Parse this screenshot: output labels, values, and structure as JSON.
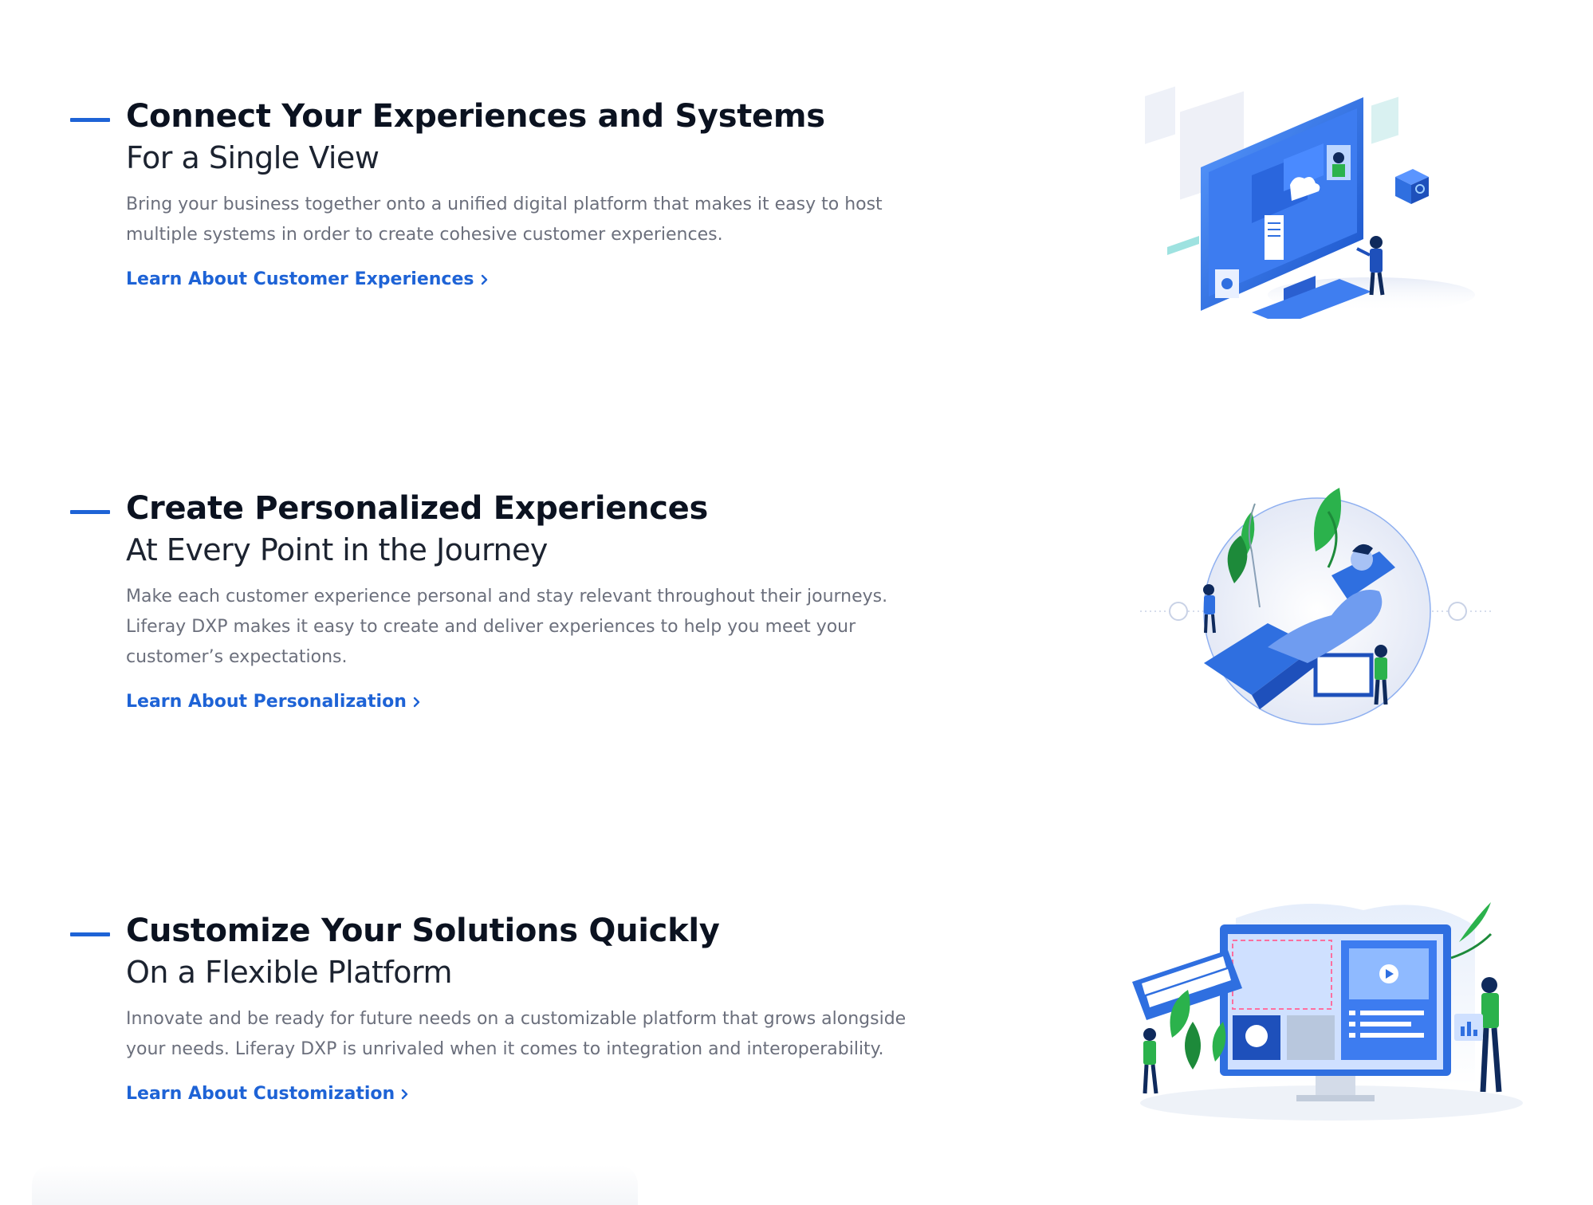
{
  "sections": [
    {
      "heading": "Connect Your Experiences and Systems",
      "subheading": "For a Single View",
      "description": "Bring your business together onto a unified digital platform that makes it easy to host multiple systems in order to create cohesive customer experiences.",
      "link_label": "Learn About Customer Experiences"
    },
    {
      "heading": "Create Personalized Experiences",
      "subheading": "At Every Point in the Journey",
      "description": "Make each customer experience personal and stay relevant throughout their journeys. Liferay DXP makes it easy to create and deliver experiences to help you meet your customer’s expectations.",
      "link_label": "Learn About Personalization"
    },
    {
      "heading": "Customize Your Solutions Quickly",
      "subheading": "On a Flexible Platform",
      "description": "Innovate and be ready for future needs on a customizable platform that grows alongside your needs. Liferay DXP is unrivaled when it comes to integration and interoperability.",
      "link_label": "Learn About Customization"
    }
  ],
  "colors": {
    "accent": "#1e63d6",
    "heading": "#0b1220",
    "body_text": "#6b6f7c",
    "illustration_green": "#2bb24c",
    "illustration_blue": "#2f6fe0"
  },
  "icons": [
    "chevron-right-icon"
  ]
}
